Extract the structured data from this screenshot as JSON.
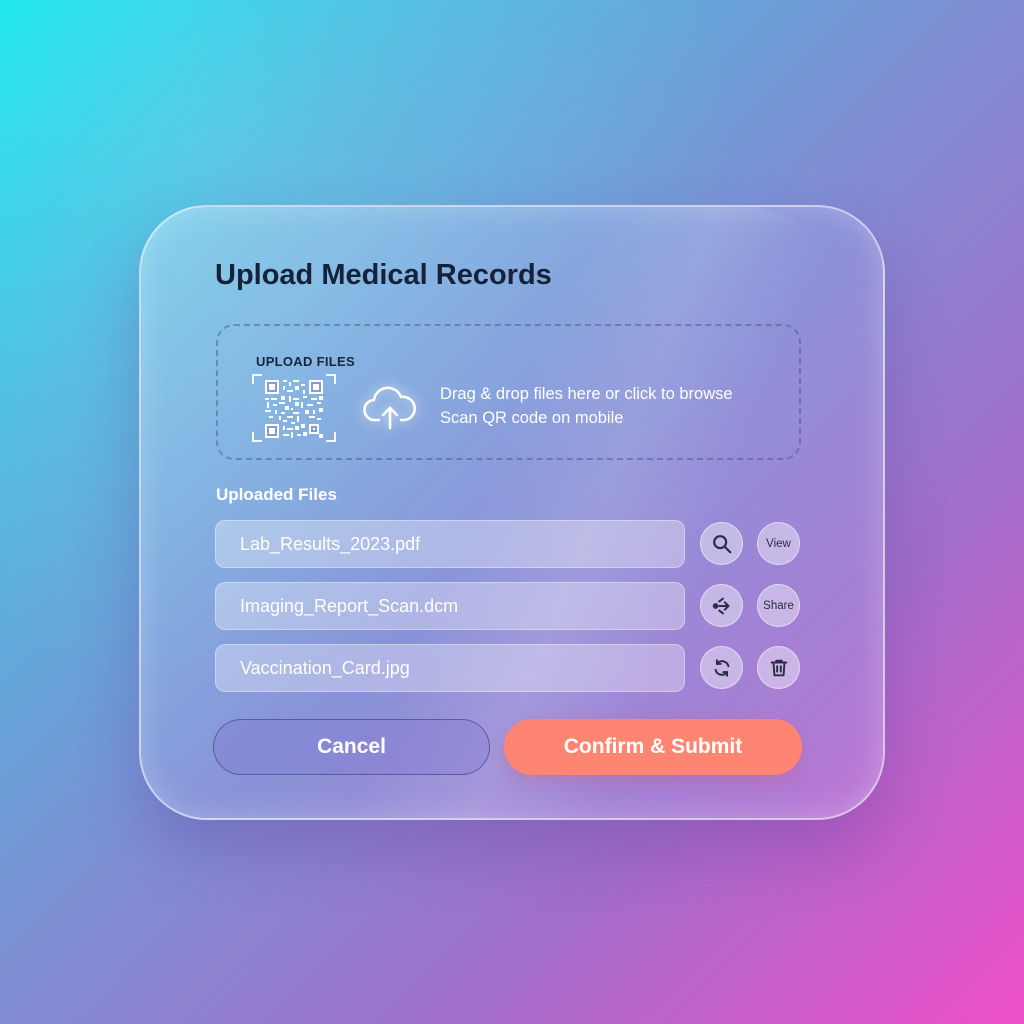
{
  "dialog": {
    "title": "Upload Medical Records"
  },
  "dropzone": {
    "label": "UPLOAD FILES",
    "line1": "Drag & drop files here or click to browse",
    "line2": "Scan QR code on mobile",
    "qr_icon": "qr-code-icon",
    "upload_icon": "cloud-upload-icon"
  },
  "uploaded": {
    "section_label": "Uploaded Files",
    "files": [
      {
        "name": "Lab_Results_2023.pdf",
        "icon_action": "search-icon",
        "text_action": "View"
      },
      {
        "name": "Imaging_Report_Scan.dcm",
        "icon_action": "share-icon",
        "text_action": "Share"
      },
      {
        "name": "Vaccination_Card.jpg",
        "icon_action": "refresh-icon",
        "icon_action_2": "trash-icon"
      }
    ]
  },
  "actions": {
    "cancel_label": "Cancel",
    "confirm_label": "Confirm & Submit"
  },
  "colors": {
    "confirm_button": "#fd8572",
    "title_text": "#16213a"
  }
}
